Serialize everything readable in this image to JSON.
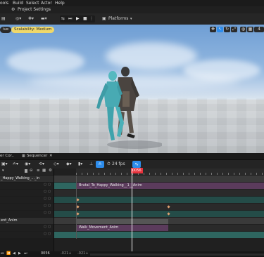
{
  "menu": [
    "ools",
    "Build",
    "Select",
    "Actor",
    "Help"
  ],
  "project_settings": "Project Settings",
  "toolbar": {
    "platforms": "Platforms"
  },
  "viewport": {
    "perspective": "ive",
    "scalability": "Scalability: Medium",
    "camera_speed": "4"
  },
  "tabs": {
    "left": "er Cor..",
    "sequencer": "Sequencer"
  },
  "sequencer": {
    "fps": "24 fps",
    "current_frame": "0056",
    "tracks": {
      "track1": "_Happy_Walking_..._in",
      "track2": "ent_Anim"
    },
    "clips": {
      "clip1": "Brutal_To_Happy_Walking__1__Anim",
      "clip2": "Walk_Movement_Anim"
    },
    "footer": {
      "frame": "0056",
      "start": "-021+",
      "mid": "-021+"
    }
  },
  "colors": {
    "accent": "#2d8ceb",
    "playhead": "#e8323c",
    "scalability_bg": "#efd86a",
    "track_purple": "#5b3b5c",
    "track_teal": "#2e6660"
  }
}
